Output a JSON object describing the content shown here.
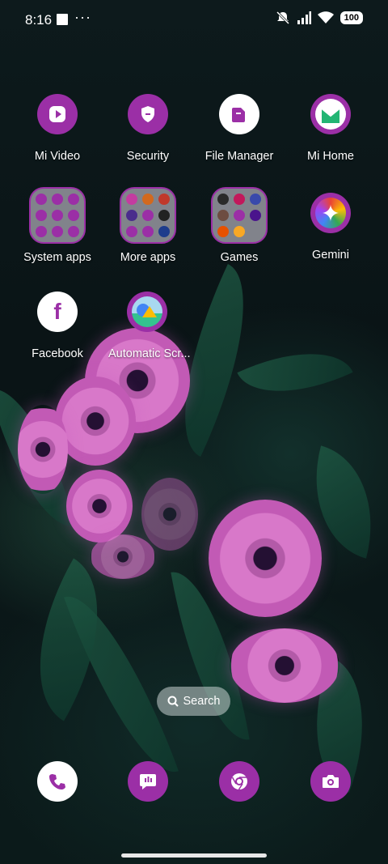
{
  "status_bar": {
    "time": "8:16",
    "more": "···",
    "battery": "100"
  },
  "apps": [
    {
      "label": "Mi Video",
      "icon": "play-icon"
    },
    {
      "label": "Security",
      "icon": "shield-icon"
    },
    {
      "label": "File Manager",
      "icon": "folder-file-icon"
    },
    {
      "label": "Mi Home",
      "icon": "mi-home-icon"
    },
    {
      "label": "System apps",
      "icon": "folder-icon"
    },
    {
      "label": "More apps",
      "icon": "folder-icon"
    },
    {
      "label": "Games",
      "icon": "folder-icon"
    },
    {
      "label": "Gemini",
      "icon": "gemini-icon"
    },
    {
      "label": "Facebook",
      "icon": "facebook-icon"
    },
    {
      "label": "Automatic Scr...",
      "icon": "photos-icon"
    }
  ],
  "search": {
    "label": "Search"
  },
  "dock": [
    {
      "name": "phone",
      "icon": "phone-icon"
    },
    {
      "name": "messages",
      "icon": "message-icon"
    },
    {
      "name": "chrome",
      "icon": "chrome-icon"
    },
    {
      "name": "camera",
      "icon": "camera-icon"
    }
  ],
  "colors": {
    "accent": "#9b2fa6"
  }
}
